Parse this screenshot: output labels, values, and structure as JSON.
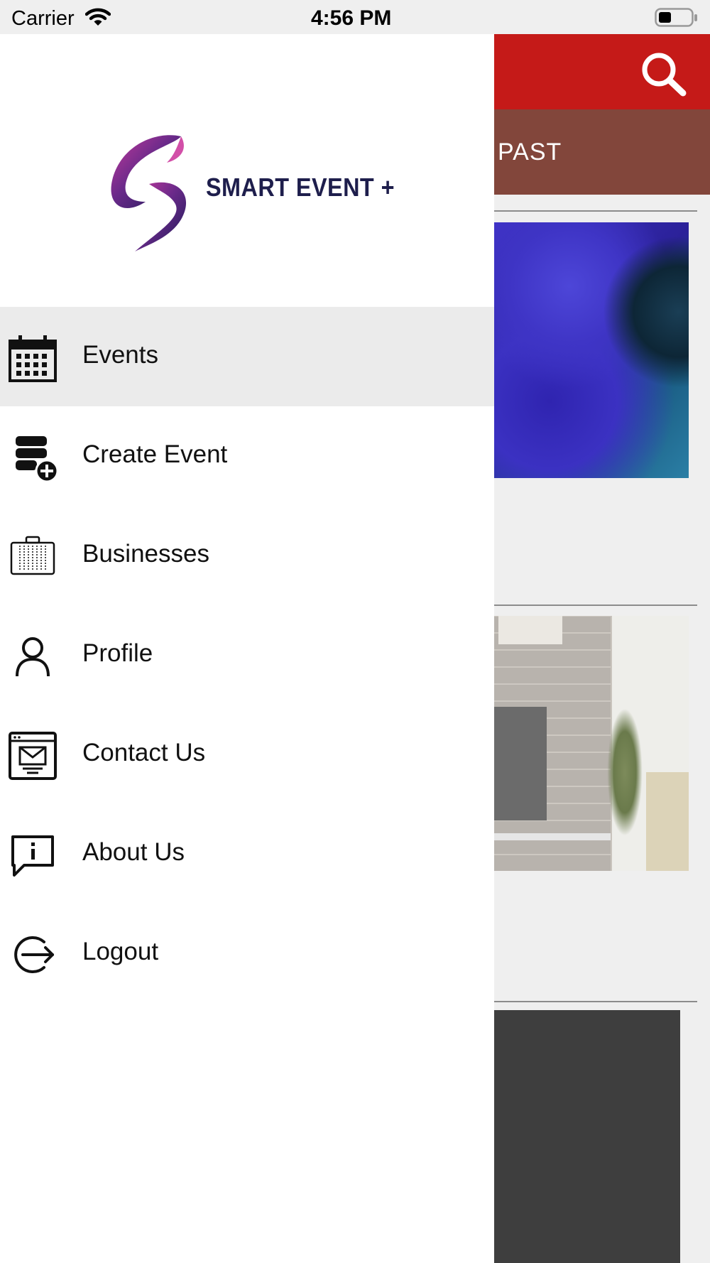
{
  "status_bar": {
    "carrier": "Carrier",
    "time": "4:56 PM"
  },
  "app": {
    "tabs": {
      "past_label": "PAST"
    },
    "accent_color": "#c51a18",
    "tab_color": "#82463b"
  },
  "drawer": {
    "logo_text": "SMART EVENT +",
    "items": [
      {
        "label": "Events",
        "icon": "calendar-icon",
        "active": true
      },
      {
        "label": "Create Event",
        "icon": "create-event-icon",
        "active": false
      },
      {
        "label": "Businesses",
        "icon": "briefcase-icon",
        "active": false
      },
      {
        "label": "Profile",
        "icon": "person-icon",
        "active": false
      },
      {
        "label": "Contact Us",
        "icon": "mail-icon",
        "active": false
      },
      {
        "label": "About Us",
        "icon": "info-chat-icon",
        "active": false
      },
      {
        "label": "Logout",
        "icon": "logout-icon",
        "active": false
      }
    ]
  }
}
